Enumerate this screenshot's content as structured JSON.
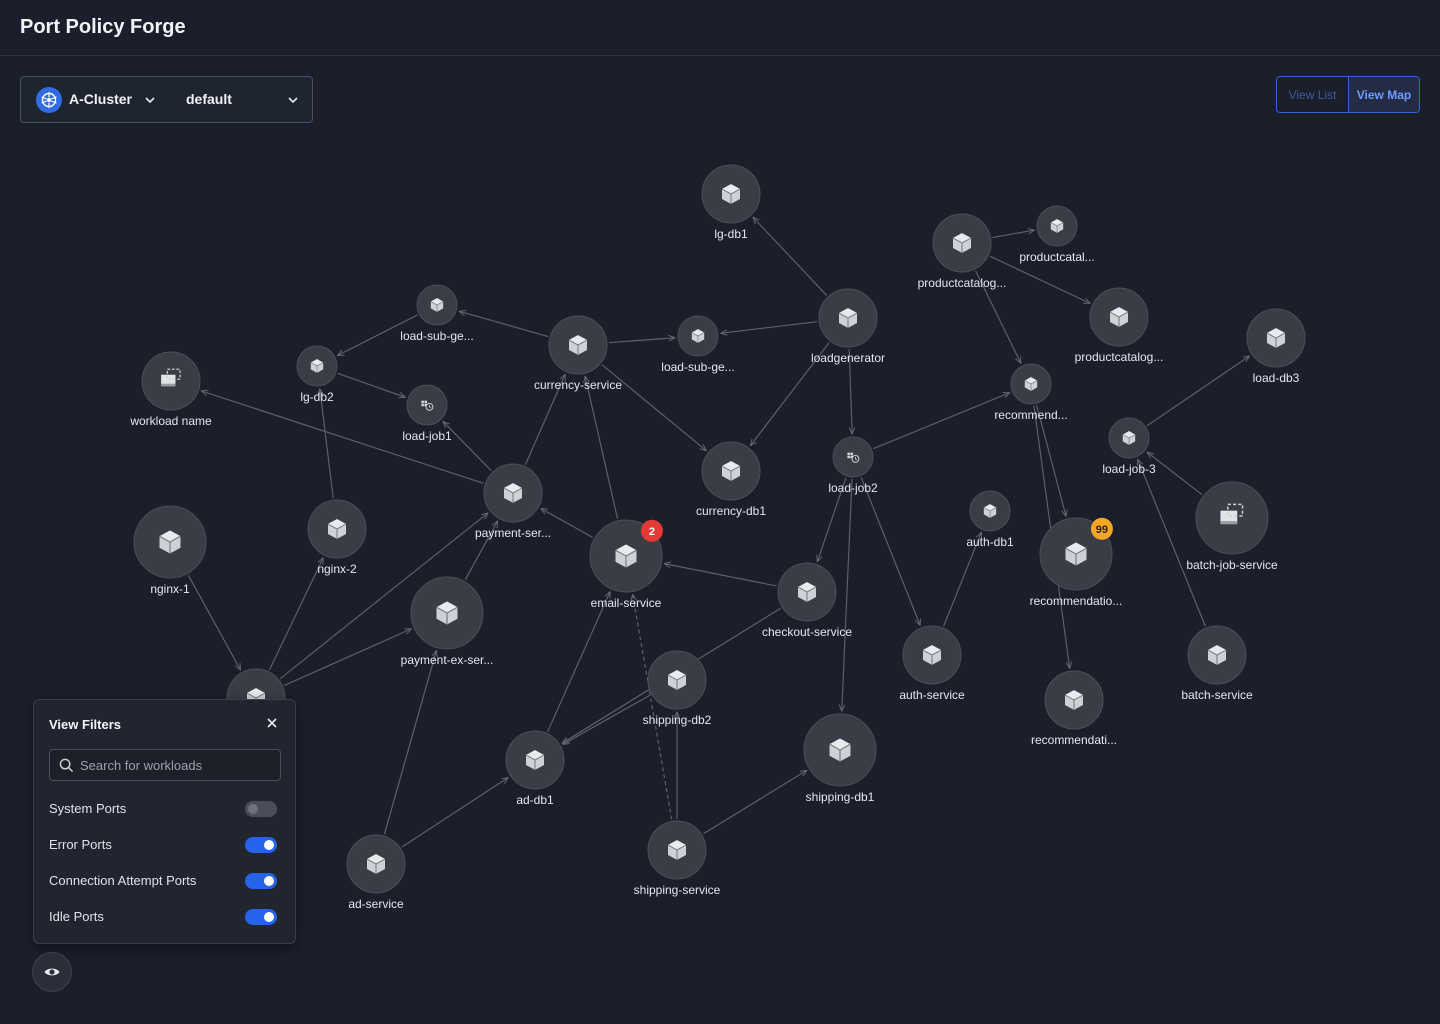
{
  "app": {
    "title": "Port Policy Forge"
  },
  "selector": {
    "cluster": "A-Cluster",
    "namespace": "default"
  },
  "view_toggle": {
    "list_label": "View List",
    "map_label": "View Map",
    "active": "View Map"
  },
  "filters": {
    "title": "View Filters",
    "search_placeholder": "Search for workloads",
    "items": [
      {
        "label": "System Ports",
        "enabled": false
      },
      {
        "label": "Error Ports",
        "enabled": true
      },
      {
        "label": "Connection Attempt Ports",
        "enabled": true
      },
      {
        "label": "Idle Ports",
        "enabled": true
      }
    ]
  },
  "colors": {
    "background": "#1b1f2b",
    "node_fill": "#3a3d45",
    "edge": "#5b606c",
    "badge_error": "#e53935",
    "badge_warning": "#f5a623",
    "toggle_on": "#2563eb",
    "accent": "#3566c9"
  },
  "graph": {
    "nodes": [
      {
        "id": "lg-db1",
        "label": "lg-db1",
        "icon": "cube-icon"
      },
      {
        "id": "productcatalog-a",
        "label": "productcatalog...",
        "icon": "cube-icon"
      },
      {
        "id": "productcatal",
        "label": "productcatal...",
        "icon": "cube-icon"
      },
      {
        "id": "productcatalog-b",
        "label": "productcatalog...",
        "icon": "cube-icon"
      },
      {
        "id": "load-sub-ge-1",
        "label": "load-sub-ge...",
        "icon": "cube-icon"
      },
      {
        "id": "currency-service",
        "label": "currency-service",
        "icon": "cube-icon"
      },
      {
        "id": "load-sub-ge-2",
        "label": "load-sub-ge...",
        "icon": "cube-icon"
      },
      {
        "id": "loadgenerator",
        "label": "loadgenerator",
        "icon": "cube-icon"
      },
      {
        "id": "load-db3",
        "label": "load-db3",
        "icon": "cube-icon"
      },
      {
        "id": "workload-name",
        "label": "workload name",
        "icon": "batch-job-icon"
      },
      {
        "id": "lg-db2",
        "label": "lg-db2",
        "icon": "cube-icon"
      },
      {
        "id": "load-job1",
        "label": "load-job1",
        "icon": "cron-job-icon"
      },
      {
        "id": "recommend",
        "label": "recommend...",
        "icon": "cube-icon"
      },
      {
        "id": "load-job-3",
        "label": "load-job-3",
        "icon": "cube-icon"
      },
      {
        "id": "currency-db1",
        "label": "currency-db1",
        "icon": "cube-icon"
      },
      {
        "id": "load-job2",
        "label": "load-job2",
        "icon": "cron-job-icon"
      },
      {
        "id": "payment-ser",
        "label": "payment-ser...",
        "icon": "cube-icon"
      },
      {
        "id": "batch-job-service",
        "label": "batch-job-service",
        "icon": "batch-job-icon"
      },
      {
        "id": "nginx-1",
        "label": "nginx-1",
        "icon": "cube-icon"
      },
      {
        "id": "nginx-2",
        "label": "nginx-2",
        "icon": "cube-icon"
      },
      {
        "id": "email-service",
        "label": "email-service",
        "icon": "cube-icon",
        "badge": "2"
      },
      {
        "id": "auth-db1",
        "label": "auth-db1",
        "icon": "cube-icon"
      },
      {
        "id": "recommendatio",
        "label": "recommendatio...",
        "icon": "cube-icon",
        "badge": "99"
      },
      {
        "id": "payment-ex-ser",
        "label": "payment-ex-ser...",
        "icon": "cube-icon"
      },
      {
        "id": "checkout-service",
        "label": "checkout-service",
        "icon": "cube-icon"
      },
      {
        "id": "auth-service",
        "label": "auth-service",
        "icon": "cube-icon"
      },
      {
        "id": "batch-service",
        "label": "batch-service",
        "icon": "cube-icon"
      },
      {
        "id": "hidden-node",
        "label": "",
        "icon": "cube-icon"
      },
      {
        "id": "shipping-db2",
        "label": "shipping-db2",
        "icon": "cube-icon"
      },
      {
        "id": "recommendati",
        "label": "recommendati...",
        "icon": "cube-icon"
      },
      {
        "id": "shipping-db1",
        "label": "shipping-db1",
        "icon": "cube-icon"
      },
      {
        "id": "ad-db1",
        "label": "ad-db1",
        "icon": "cube-icon"
      },
      {
        "id": "ad-service",
        "label": "ad-service",
        "icon": "cube-icon"
      },
      {
        "id": "shipping-service",
        "label": "shipping-service",
        "icon": "cube-icon"
      }
    ],
    "edges": [
      [
        "loadgenerator",
        "lg-db1"
      ],
      [
        "loadgenerator",
        "load-sub-ge-2"
      ],
      [
        "loadgenerator",
        "currency-db1"
      ],
      [
        "loadgenerator",
        "load-job2"
      ],
      [
        "currency-service",
        "load-sub-ge-1"
      ],
      [
        "load-sub-ge-1",
        "lg-db2"
      ],
      [
        "lg-db2",
        "load-job1"
      ],
      [
        "currency-service",
        "load-sub-ge-2"
      ],
      [
        "currency-service",
        "currency-db1"
      ],
      [
        "payment-ser",
        "currency-service"
      ],
      [
        "payment-ser",
        "workload-name"
      ],
      [
        "payment-ser",
        "load-job1"
      ],
      [
        "email-service",
        "payment-ser"
      ],
      [
        "email-service",
        "currency-service"
      ],
      [
        "nginx-2",
        "lg-db2"
      ],
      [
        "nginx-1",
        "hidden-node"
      ],
      [
        "hidden-node",
        "nginx-2"
      ],
      [
        "hidden-node",
        "payment-ser"
      ],
      [
        "hidden-node",
        "payment-ex-ser"
      ],
      [
        "payment-ex-ser",
        "payment-ser"
      ],
      [
        "checkout-service",
        "email-service"
      ],
      [
        "checkout-service",
        "ad-db1"
      ],
      [
        "load-job2",
        "checkout-service"
      ],
      [
        "load-job2",
        "recommend"
      ],
      [
        "load-job2",
        "auth-service"
      ],
      [
        "load-job2",
        "shipping-db1"
      ],
      [
        "productcatalog-a",
        "productcatal"
      ],
      [
        "productcatalog-a",
        "productcatalog-b"
      ],
      [
        "productcatalog-a",
        "recommend"
      ],
      [
        "recommend",
        "recommendatio"
      ],
      [
        "recommend",
        "recommendati"
      ],
      [
        "load-job-3",
        "load-db3"
      ],
      [
        "batch-job-service",
        "load-job-3"
      ],
      [
        "batch-service",
        "load-job-3"
      ],
      [
        "auth-service",
        "auth-db1"
      ],
      [
        "ad-db1",
        "email-service"
      ],
      [
        "shipping-db2",
        "ad-db1"
      ],
      [
        "ad-service",
        "ad-db1"
      ],
      [
        "ad-service",
        "payment-ex-ser"
      ],
      [
        "shipping-service",
        "shipping-db2"
      ],
      [
        "shipping-service",
        "shipping-db1"
      ],
      [
        "shipping-service",
        "email-service",
        "dashed"
      ]
    ]
  }
}
